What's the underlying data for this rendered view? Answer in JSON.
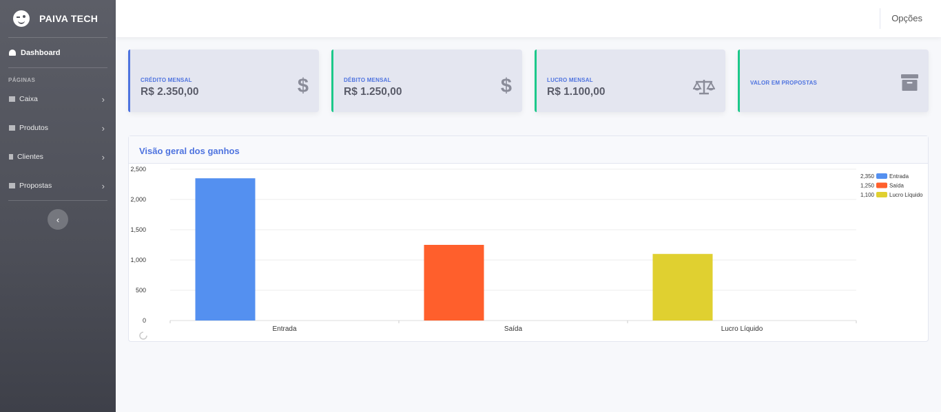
{
  "brand": {
    "name": "PAIVA TECH"
  },
  "sidebar": {
    "dashboard_label": "Dashboard",
    "section_heading": "PÁGINAS",
    "items": [
      {
        "label": "Caixa",
        "icon": "bank-icon"
      },
      {
        "label": "Produtos",
        "icon": "cart-icon"
      },
      {
        "label": "Clientes",
        "icon": "user-icon"
      },
      {
        "label": "Propostas",
        "icon": "folder-icon"
      }
    ],
    "toggle_icon": "‹"
  },
  "topbar": {
    "options_label": "Opções"
  },
  "cards": [
    {
      "title": "CRÉDITO MENSAL",
      "value": "R$ 2.350,00",
      "icon": "dollar-icon",
      "accent": "#4e73df"
    },
    {
      "title": "DÉBITO MENSAL",
      "value": "R$ 1.250,00",
      "icon": "dollar-icon",
      "accent": "#1cc88a"
    },
    {
      "title": "LUCRO MENSAL",
      "value": "R$ 1.100,00",
      "icon": "balance-scale-icon",
      "accent": "#1cc88a"
    },
    {
      "title": "VALOR EM PROPOSTAS",
      "value": "",
      "icon": "archive-icon",
      "accent": "#1cc88a"
    }
  ],
  "panel": {
    "title": "Visão geral dos ganhos"
  },
  "chart_data": {
    "type": "bar",
    "categories": [
      "Entrada",
      "Saída",
      "Lucro Líquido"
    ],
    "values": [
      2350,
      1250,
      1100
    ],
    "colors": [
      "#5490f0",
      "#ff5f2c",
      "#e0d030"
    ],
    "ylim": [
      0,
      2500
    ],
    "yticks": [
      "2,500",
      "2,000",
      "1,500",
      "1,000",
      "500",
      "0"
    ],
    "ytick_values": [
      2500,
      2000,
      1500,
      1000,
      500,
      0
    ],
    "legend": [
      {
        "value_label": "2,350",
        "name": "Entrada"
      },
      {
        "value_label": "1,250",
        "name": "Saída"
      },
      {
        "value_label": "1,100",
        "name": "Lucro Líquido"
      }
    ],
    "legend_position": "top-right",
    "grid": true
  }
}
